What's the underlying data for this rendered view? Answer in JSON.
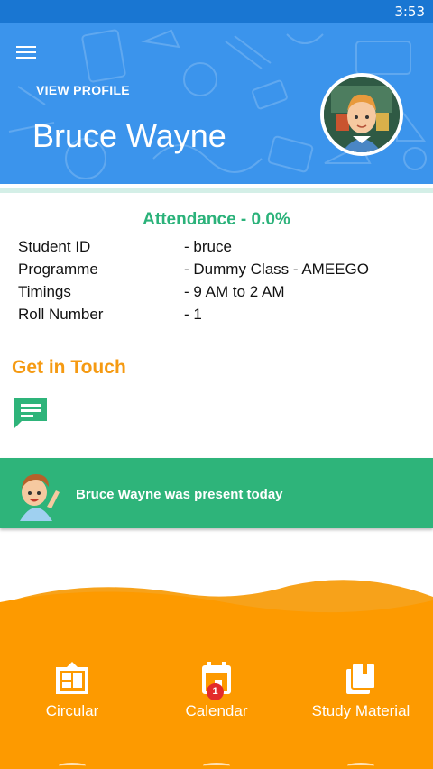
{
  "status_bar": {
    "time": "3:53"
  },
  "header": {
    "view_profile_label": "VIEW PROFILE",
    "student_name": "Bruce Wayne",
    "background_color": "#3b94ec"
  },
  "attendance": {
    "text": "Attendance - 0.0%",
    "color": "#2bb27a"
  },
  "student_info": [
    {
      "label": "Student ID",
      "value": "- bruce"
    },
    {
      "label": "Programme",
      "value": "- Dummy Class - AMEEGO"
    },
    {
      "label": "Timings",
      "value": "- 9 AM to 2 AM"
    },
    {
      "label": "Roll Number",
      "value": "- 1"
    }
  ],
  "get_in_touch": {
    "title": "Get in Touch",
    "icon": "chat-message-icon",
    "color": "#f59a12"
  },
  "presence_banner": {
    "text": "Bruce Wayne was present today",
    "color": "#2eb47a"
  },
  "bottom_nav": {
    "background_color": "#fd9a00",
    "items": [
      {
        "label": "Circular",
        "icon": "circular-board-icon"
      },
      {
        "label": "Calendar",
        "icon": "calendar-icon",
        "badge": "1"
      },
      {
        "label": "Study Material",
        "icon": "books-icon"
      }
    ]
  }
}
